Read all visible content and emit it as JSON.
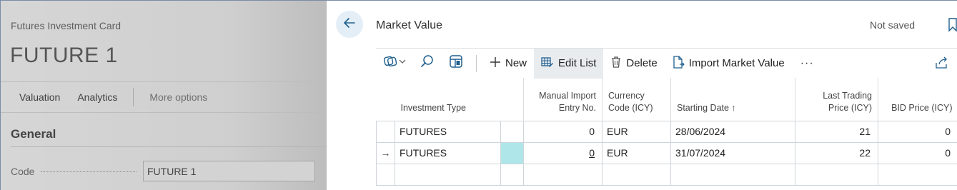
{
  "background_card": {
    "caption": "Futures Investment Card",
    "title": "FUTURE 1",
    "actions": [
      "Valuation",
      "Analytics"
    ],
    "more_options": "More options",
    "section": "General",
    "field_label": "Code",
    "field_value": "FUTURE 1"
  },
  "list_page": {
    "title": "Market Value",
    "status": "Not saved",
    "toolbar": {
      "new": "New",
      "edit_list": "Edit List",
      "delete": "Delete",
      "import_market_value": "Import Market Value",
      "more": "···"
    },
    "columns": {
      "investment_type": "Investment Type",
      "manual_import_1": "Manual Import",
      "manual_import_2": "Entry No.",
      "currency_1": "Currency",
      "currency_2": "Code (ICY)",
      "starting_date": "Starting Date",
      "starting_date_sort": "↑",
      "last_trading_1": "Last Trading",
      "last_trading_2": "Price (ICY)",
      "bid_price": "BID Price (ICY)"
    },
    "rows": [
      {
        "indicator": "",
        "investment_type": "FUTURES",
        "entry_no": "0",
        "currency": "EUR",
        "starting_date": "28/06/2024",
        "last_trading_price": "21",
        "bid_price": "0"
      },
      {
        "indicator": "→",
        "investment_type": "FUTURES",
        "entry_no": "0",
        "currency": "EUR",
        "starting_date": "31/07/2024",
        "last_trading_price": "22",
        "bid_price": "0"
      }
    ]
  },
  "colors": {
    "selected_cell": "#aee6ea",
    "back_button_bg": "#e4eef7",
    "accent": "#1f5f8f"
  }
}
